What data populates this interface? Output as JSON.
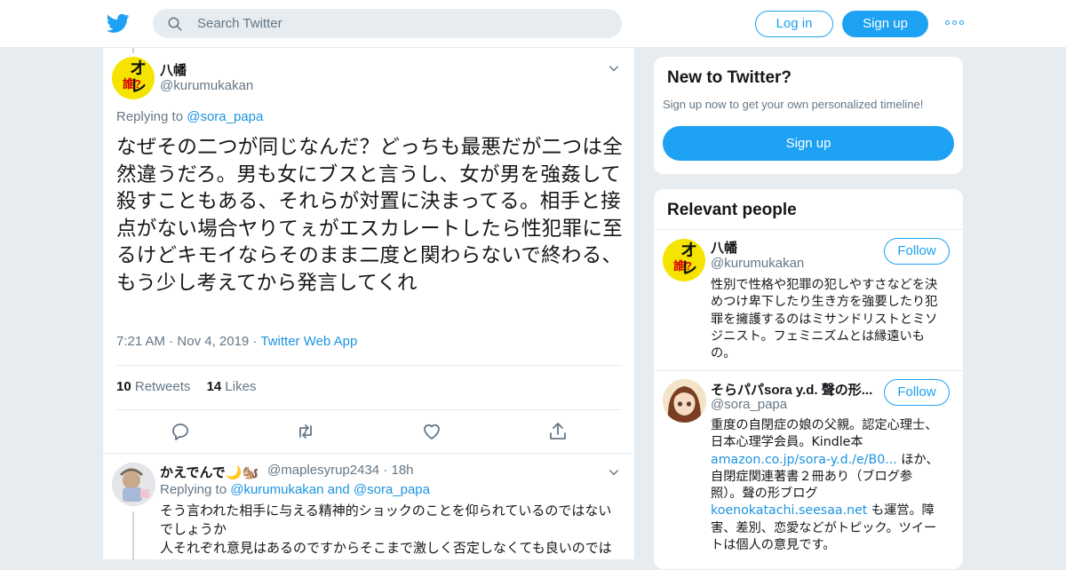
{
  "colors": {
    "accent": "#1da1f2",
    "link": "#1b95e0",
    "muted": "#657786",
    "text": "#14171a",
    "background": "#e6ecf0"
  },
  "header": {
    "search_placeholder": "Search Twitter",
    "login_label": "Log in",
    "signup_label": "Sign up",
    "icons": [
      "twitter-bird-icon",
      "search-icon",
      "more-icon"
    ]
  },
  "tweet": {
    "author_name": "八幡",
    "author_handle": "@kurumukakan",
    "avatar_text_top": "オレ",
    "avatar_text_bottom": "誰?",
    "replying_prefix": "Replying to",
    "replying_to": "@sora_papa",
    "text": "なぜその二つが同じなんだ？どっちも最悪だが二つは全然違うだろ。男も女にブスと言うし、女が男を強姦して殺すこともある、それらが対置に決まってる。相手と接点がない場合ヤりてぇがエスカレートしたら性犯罪に至るけどキモイならそのまま二度と関わらないで終わる、もう少し考えてから発言してくれ",
    "time": "7:21 AM",
    "date": "Nov 4, 2019",
    "source": "Twitter Web App",
    "retweets_count": "10",
    "retweets_label": "Retweets",
    "likes_count": "14",
    "likes_label": "Likes",
    "actions": [
      "reply-icon",
      "retweet-icon",
      "like-icon",
      "share-icon"
    ]
  },
  "reply": {
    "author_name": "かえでんで🌙🐿️",
    "author_handle": "@maplesyrup2434",
    "time_sep": "·",
    "time": "18h",
    "replying_prefix": "Replying to",
    "replying_to_1": "@kurumukakan",
    "replying_and": "and",
    "replying_to_2": "@sora_papa",
    "line1": "そう言われた相手に与える精神的ショックのことを仰られているのではないでしょうか",
    "line2": "人それぞれ意見はあるのですからそこまで激しく否定しなくても良いのではないでしょうか"
  },
  "sidebar": {
    "new_title": "New to Twitter?",
    "new_sub": "Sign up now to get your own personalized timeline!",
    "signup_label": "Sign up",
    "relevant_title": "Relevant people",
    "follow_label": "Follow",
    "people": [
      {
        "name": "八幡",
        "handle": "@kurumukakan",
        "bio": "性別で性格や犯罪の犯しやすさなどを決めつけ卑下したり生き方を強要したり犯罪を擁護するのはミサンドリストとミソジニスト。フェミニズムとは縁遠いもの。"
      },
      {
        "name": "そらパパsora y.d. 聲の形...",
        "handle": "@sora_papa",
        "bio_1": "重度の自閉症の娘の父親。認定心理士、日本心理学会員。Kindle本",
        "bio_link_1": "amazon.co.jp/sora-y.d./e/B0...",
        "bio_2": " ほか、自閉症関連著書２冊あり（ブログ参照）。聲の形ブログ",
        "bio_link_2": "koenokatachi.seesaa.net",
        "bio_3": " も運営。障害、差別、恋愛などがトピック。ツイートは個人の意見です。"
      }
    ]
  }
}
